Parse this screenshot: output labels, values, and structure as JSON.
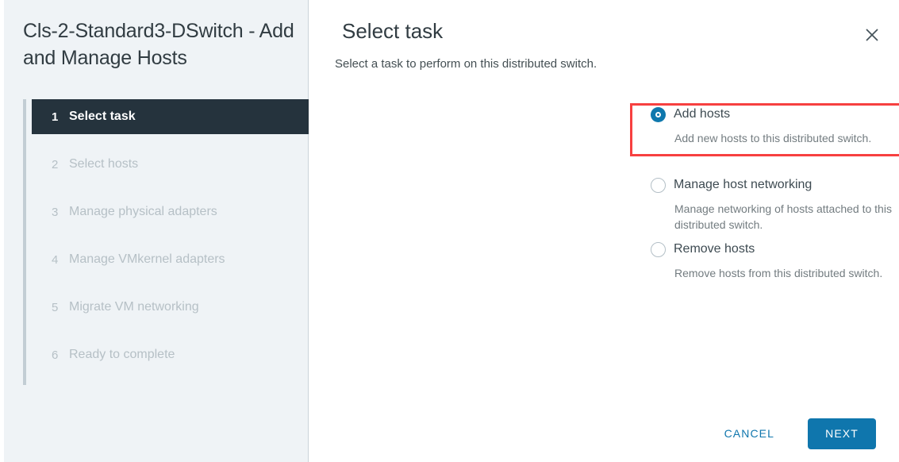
{
  "wizard": {
    "title": "Cls-2-Standard3-DSwitch - Add and Manage Hosts",
    "steps": [
      {
        "number": "1",
        "label": "Select task"
      },
      {
        "number": "2",
        "label": "Select hosts"
      },
      {
        "number": "3",
        "label": "Manage physical adapters"
      },
      {
        "number": "4",
        "label": "Manage VMkernel adapters"
      },
      {
        "number": "5",
        "label": "Migrate VM networking"
      },
      {
        "number": "6",
        "label": "Ready to complete"
      }
    ]
  },
  "panel": {
    "title": "Select task",
    "subtitle": "Select a task to perform on this distributed switch.",
    "close_icon": "close-icon"
  },
  "options": [
    {
      "label": "Add hosts",
      "description": "Add new hosts to this distributed switch.",
      "selected": "selected"
    },
    {
      "label": "Manage host networking",
      "description": "Manage networking of hosts attached to this distributed switch.",
      "selected": ""
    },
    {
      "label": "Remove hosts",
      "description": "Remove hosts from this distributed switch.",
      "selected": ""
    }
  ],
  "footer": {
    "cancel_label": "CANCEL",
    "next_label": "NEXT"
  },
  "colors": {
    "accent_blue": "#0f76ad",
    "active_step_bg": "#25333d",
    "sidebar_bg": "#eff3f6",
    "highlight_red": "#f74040",
    "muted_text": "#b6c0c6"
  }
}
